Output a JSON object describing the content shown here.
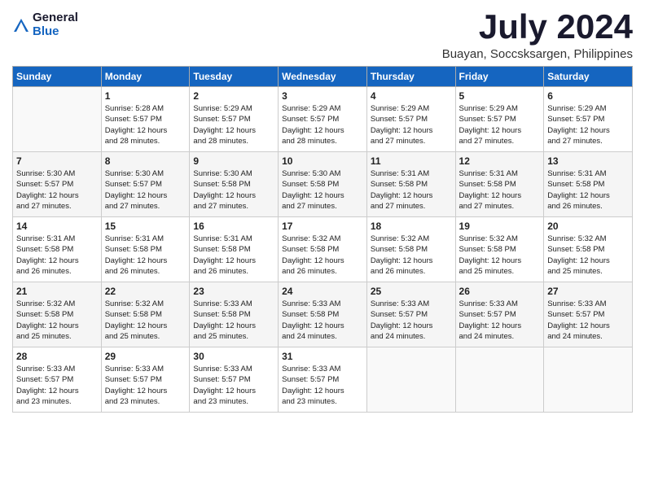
{
  "header": {
    "logo_general": "General",
    "logo_blue": "Blue",
    "title": "July 2024",
    "location": "Buayan, Soccsksargen, Philippines"
  },
  "days_of_week": [
    "Sunday",
    "Monday",
    "Tuesday",
    "Wednesday",
    "Thursday",
    "Friday",
    "Saturday"
  ],
  "weeks": [
    [
      {
        "day": "",
        "info": ""
      },
      {
        "day": "1",
        "info": "Sunrise: 5:28 AM\nSunset: 5:57 PM\nDaylight: 12 hours\nand 28 minutes."
      },
      {
        "day": "2",
        "info": "Sunrise: 5:29 AM\nSunset: 5:57 PM\nDaylight: 12 hours\nand 28 minutes."
      },
      {
        "day": "3",
        "info": "Sunrise: 5:29 AM\nSunset: 5:57 PM\nDaylight: 12 hours\nand 28 minutes."
      },
      {
        "day": "4",
        "info": "Sunrise: 5:29 AM\nSunset: 5:57 PM\nDaylight: 12 hours\nand 27 minutes."
      },
      {
        "day": "5",
        "info": "Sunrise: 5:29 AM\nSunset: 5:57 PM\nDaylight: 12 hours\nand 27 minutes."
      },
      {
        "day": "6",
        "info": "Sunrise: 5:29 AM\nSunset: 5:57 PM\nDaylight: 12 hours\nand 27 minutes."
      }
    ],
    [
      {
        "day": "7",
        "info": "Sunrise: 5:30 AM\nSunset: 5:57 PM\nDaylight: 12 hours\nand 27 minutes."
      },
      {
        "day": "8",
        "info": "Sunrise: 5:30 AM\nSunset: 5:57 PM\nDaylight: 12 hours\nand 27 minutes."
      },
      {
        "day": "9",
        "info": "Sunrise: 5:30 AM\nSunset: 5:58 PM\nDaylight: 12 hours\nand 27 minutes."
      },
      {
        "day": "10",
        "info": "Sunrise: 5:30 AM\nSunset: 5:58 PM\nDaylight: 12 hours\nand 27 minutes."
      },
      {
        "day": "11",
        "info": "Sunrise: 5:31 AM\nSunset: 5:58 PM\nDaylight: 12 hours\nand 27 minutes."
      },
      {
        "day": "12",
        "info": "Sunrise: 5:31 AM\nSunset: 5:58 PM\nDaylight: 12 hours\nand 27 minutes."
      },
      {
        "day": "13",
        "info": "Sunrise: 5:31 AM\nSunset: 5:58 PM\nDaylight: 12 hours\nand 26 minutes."
      }
    ],
    [
      {
        "day": "14",
        "info": "Sunrise: 5:31 AM\nSunset: 5:58 PM\nDaylight: 12 hours\nand 26 minutes."
      },
      {
        "day": "15",
        "info": "Sunrise: 5:31 AM\nSunset: 5:58 PM\nDaylight: 12 hours\nand 26 minutes."
      },
      {
        "day": "16",
        "info": "Sunrise: 5:31 AM\nSunset: 5:58 PM\nDaylight: 12 hours\nand 26 minutes."
      },
      {
        "day": "17",
        "info": "Sunrise: 5:32 AM\nSunset: 5:58 PM\nDaylight: 12 hours\nand 26 minutes."
      },
      {
        "day": "18",
        "info": "Sunrise: 5:32 AM\nSunset: 5:58 PM\nDaylight: 12 hours\nand 26 minutes."
      },
      {
        "day": "19",
        "info": "Sunrise: 5:32 AM\nSunset: 5:58 PM\nDaylight: 12 hours\nand 25 minutes."
      },
      {
        "day": "20",
        "info": "Sunrise: 5:32 AM\nSunset: 5:58 PM\nDaylight: 12 hours\nand 25 minutes."
      }
    ],
    [
      {
        "day": "21",
        "info": "Sunrise: 5:32 AM\nSunset: 5:58 PM\nDaylight: 12 hours\nand 25 minutes."
      },
      {
        "day": "22",
        "info": "Sunrise: 5:32 AM\nSunset: 5:58 PM\nDaylight: 12 hours\nand 25 minutes."
      },
      {
        "day": "23",
        "info": "Sunrise: 5:33 AM\nSunset: 5:58 PM\nDaylight: 12 hours\nand 25 minutes."
      },
      {
        "day": "24",
        "info": "Sunrise: 5:33 AM\nSunset: 5:58 PM\nDaylight: 12 hours\nand 24 minutes."
      },
      {
        "day": "25",
        "info": "Sunrise: 5:33 AM\nSunset: 5:57 PM\nDaylight: 12 hours\nand 24 minutes."
      },
      {
        "day": "26",
        "info": "Sunrise: 5:33 AM\nSunset: 5:57 PM\nDaylight: 12 hours\nand 24 minutes."
      },
      {
        "day": "27",
        "info": "Sunrise: 5:33 AM\nSunset: 5:57 PM\nDaylight: 12 hours\nand 24 minutes."
      }
    ],
    [
      {
        "day": "28",
        "info": "Sunrise: 5:33 AM\nSunset: 5:57 PM\nDaylight: 12 hours\nand 23 minutes."
      },
      {
        "day": "29",
        "info": "Sunrise: 5:33 AM\nSunset: 5:57 PM\nDaylight: 12 hours\nand 23 minutes."
      },
      {
        "day": "30",
        "info": "Sunrise: 5:33 AM\nSunset: 5:57 PM\nDaylight: 12 hours\nand 23 minutes."
      },
      {
        "day": "31",
        "info": "Sunrise: 5:33 AM\nSunset: 5:57 PM\nDaylight: 12 hours\nand 23 minutes."
      },
      {
        "day": "",
        "info": ""
      },
      {
        "day": "",
        "info": ""
      },
      {
        "day": "",
        "info": ""
      }
    ]
  ]
}
